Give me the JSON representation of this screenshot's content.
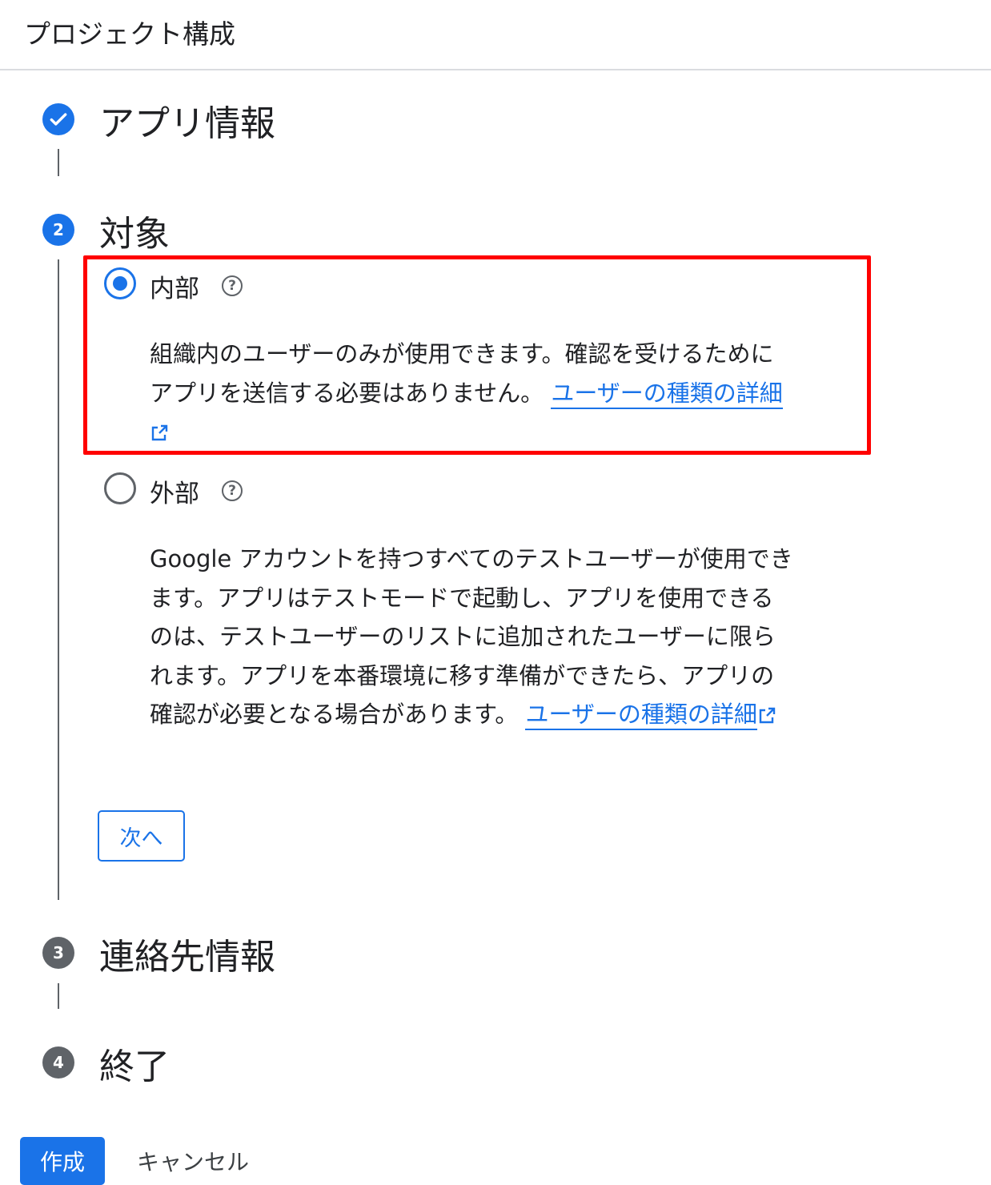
{
  "header": {
    "title": "プロジェクト構成"
  },
  "steps": [
    {
      "number": "1",
      "title": "アプリ情報",
      "status": "completed",
      "icon": "check-icon"
    },
    {
      "number": "2",
      "title": "対象",
      "status": "active"
    },
    {
      "number": "3",
      "title": "連絡先情報",
      "status": "pending"
    },
    {
      "number": "4",
      "title": "終了",
      "status": "pending"
    }
  ],
  "audience": {
    "internal": {
      "label": "内部",
      "selected": true,
      "description_line1": "組織内のユーザーのみが使用できます。確認を受けるために",
      "description_line2": "アプリを送信する必要はありません。",
      "link": "ユーザーの種類の詳細"
    },
    "external": {
      "label": "外部",
      "selected": false,
      "description_line1": "Google アカウントを持つすべてのテストユーザーが使用でき",
      "description_line2": "ます。アプリはテストモードで起動し、アプリを使用できる",
      "description_line3": "のは、テストユーザーのリストに追加されたユーザーに限ら",
      "description_line4": "れます。アプリを本番環境に移す準備ができたら、アプリの",
      "description_line5": "確認が必要となる場合があります。",
      "link": "ユーザーの種類の詳細"
    },
    "next_button": "次へ"
  },
  "footer": {
    "create_button": "作成",
    "cancel_button": "キャンセル"
  },
  "colors": {
    "accent": "#1a73e8",
    "highlight": "#ff0000",
    "pending": "#5f6368"
  }
}
